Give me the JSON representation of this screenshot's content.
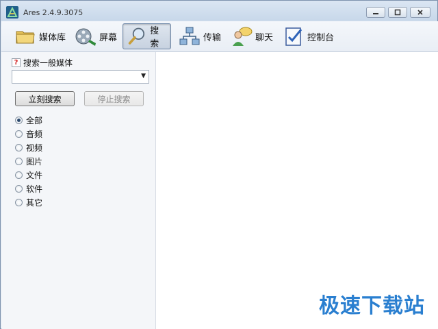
{
  "window": {
    "title": "Ares 2.4.9.3075",
    "controls": {
      "minimize_icon": "minimize-icon",
      "maximize_icon": "maximize-icon",
      "close_icon": "close-icon"
    }
  },
  "toolbar": {
    "active_tab": "search",
    "tabs": [
      {
        "id": "library",
        "label": "媒体库",
        "icon": "folder-icon"
      },
      {
        "id": "screen",
        "label": "屏幕",
        "icon": "film-reel-icon"
      },
      {
        "id": "search",
        "label": "搜索",
        "icon": "magnifier-icon"
      },
      {
        "id": "transfer",
        "label": "传输",
        "icon": "network-icon"
      },
      {
        "id": "chat",
        "label": "聊天",
        "icon": "chat-users-icon"
      },
      {
        "id": "control",
        "label": "控制台",
        "icon": "control-panel-icon"
      }
    ]
  },
  "search_panel": {
    "header": "搜索一般媒体",
    "query_value": "",
    "search_now": "立刻搜索",
    "stop_search": "停止搜索",
    "selected_type": "全部",
    "types": [
      "全部",
      "音频",
      "视频",
      "图片",
      "文件",
      "软件",
      "其它"
    ]
  },
  "watermark": "极速下载站",
  "colors": {
    "accent": "#2a7fd0",
    "active_tab_bg": "#c7d2e0"
  }
}
